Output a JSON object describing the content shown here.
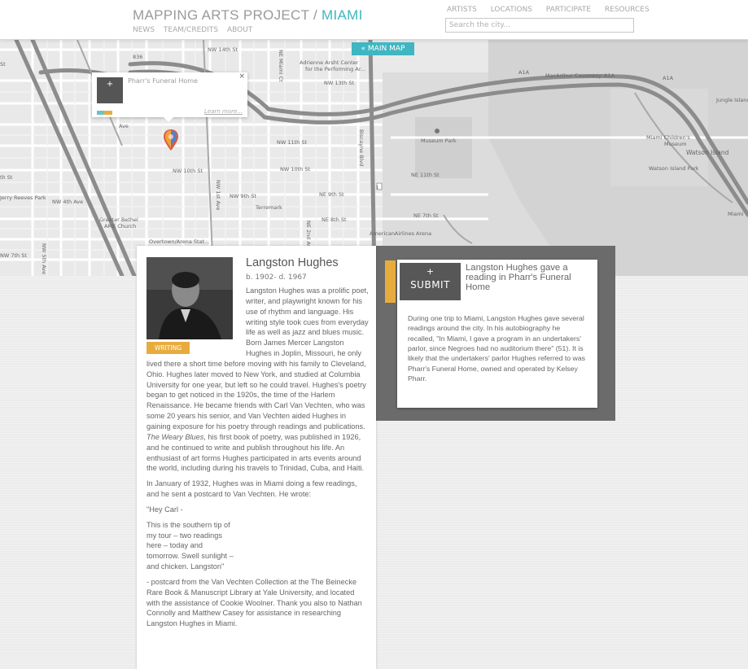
{
  "header": {
    "brand_main": "MAPPING ARTS PROJECT / ",
    "brand_city": "MIAMI",
    "subnav": [
      "NEWS",
      "TEAM/CREDITS",
      "ABOUT"
    ],
    "topnav": [
      "ARTISTS",
      "LOCATIONS",
      "PARTICIPATE",
      "RESOURCES"
    ],
    "search_placeholder": "Search the city..."
  },
  "map": {
    "main_map_button": "« MAIN MAP",
    "popup": {
      "plus": "+",
      "title": "Pharr's Funeral Home",
      "learn_more": "Learn more...",
      "close": "×"
    },
    "labels": {
      "nw14": "NW 14th St",
      "adrienne": "Adrienne Arsht Center",
      "perf": "for the Performing Ar...",
      "nw13": "NW 13th St",
      "macarthur": "MacArthur Causeway",
      "a1a1": "A1A",
      "a1a2": "A1A",
      "a1a3": "A1A",
      "jungle": "Jungle Island",
      "museum_park": "Museum Park",
      "childrens": "Miami Children's",
      "museum": "Museum",
      "watson": "Watson Island",
      "watson_park": "Watson Island Park",
      "nw11": "NW 11th St",
      "ne11": "NE 11th St",
      "nw10a": "NW 10th St",
      "nw10b": "NW 10th St",
      "nw9": "NW 9th St",
      "ne9": "NE 9th St",
      "terremark": "Terremark",
      "ne8": "NE 8th St",
      "ne7": "NE 7th St",
      "jerry": "Jerry Reeves Park",
      "nw4": "NW 4th Ave",
      "bethel": "Greater Bethel",
      "church": "AME Church",
      "overtown": "Overtown/Arena Stat...",
      "aa": "AmericanAirlines Arena",
      "nw7": "NW 7th St",
      "nw5": "NW 5th Ave",
      "nw1ave": "NW 1st Ave",
      "miami_ave": "NE Miami Ct",
      "biscayne": "Biscayne Blvd",
      "n2nd": "NE 2nd Ave",
      "miami": "Miami",
      "r836": "836",
      "r1": "1",
      "st": "St",
      "ave": "Ave",
      "th": "th St"
    }
  },
  "bio": {
    "name": "Langston Hughes",
    "dates": "b. 1902- d. 1967",
    "tag": "WRITING",
    "para1_a": "Langston Hughes was a prolific poet, writer, and playwright known for his use of rhythm and language. His writing style took cues from everyday life as well as jazz and blues music. Born James Mercer Langston Hughes in Joplin, Missouri, he only lived there a short time before moving with his family to Cleveland, Ohio. Hughes later moved to New York, and studied at Columbia University for one year, but left so he could travel. Hughes's poetry began to get noticed in the 1920s, the time of the Harlem Renaissance. He became friends with Carl Van Vechten, who was some 20 years his senior, and Van Vechten aided Hughes in gaining exposure for his poetry through readings and publications. ",
    "para1_em": "The Weary Blues",
    "para1_b": ", his first book of poetry, was published in 1926, and he continued to write and publish throughout his life. An enthusiast of art forms Hughes participated in arts events around the world, including during his travels to Trinidad, Cuba, and Haiti.",
    "para2": "In January of 1932, Hughes was in Miami doing a few readings, and he sent a postcard to Van Vechten. He wrote:",
    "quote1": "\"Hey Carl -",
    "quote2": "This is the southern tip of my tour – two readings here – today and tomorrow. Swell sunlight – and chicken. Langston\"",
    "para3": "- postcard from the Van Vechten Collection at the The Beinecke Rare Book & Manuscript Library at Yale University, and located with the assistance of Cookie Woolner. Thank you also to Nathan Connolly and Matthew Casey for assistance in researching Langston Hughes in Miami."
  },
  "event": {
    "plus": "+",
    "submit_label": "SUBMIT",
    "title": "Langston Hughes gave a reading in Pharr's Funeral Home",
    "text": "During one trip to Miami, Langston Hughes gave several readings around the city. In his autobiography he recalled, \"In Miami, I gave a program in an undertakers' parlor, since Negroes had no auditorium there\" (51). It is likely that the undertakers' parlor Hughes referred to was Pharr's Funeral Home, owned and operated by Kelsey Pharr."
  },
  "colors": {
    "accent_teal": "#3fb6c1",
    "accent_orange": "#e8ac3e",
    "panel_gray": "#6b6b6b"
  }
}
